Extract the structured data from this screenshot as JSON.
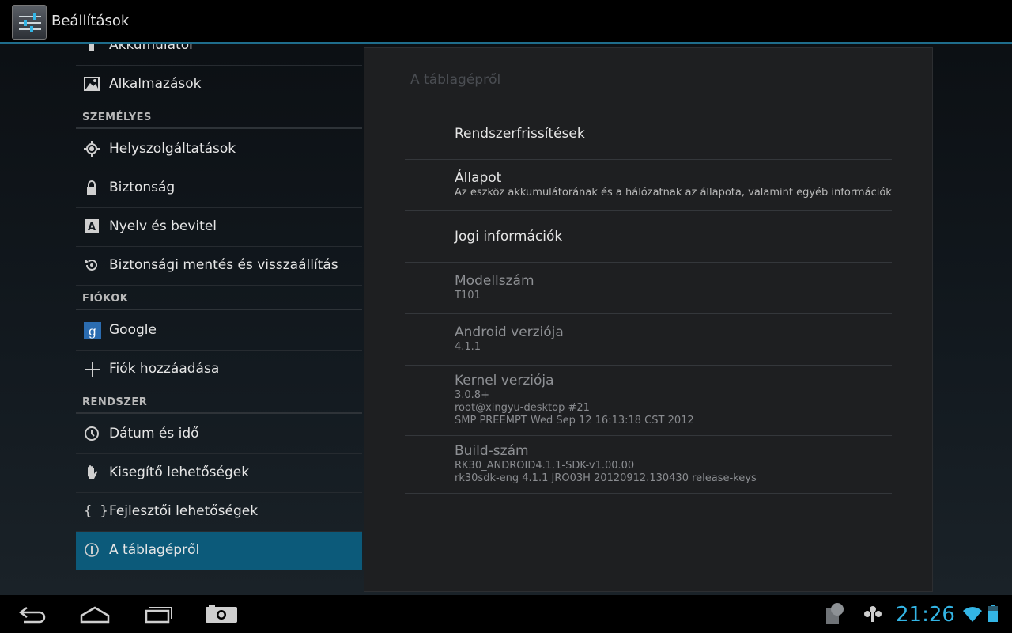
{
  "app": {
    "title": "Beállítások"
  },
  "sidebar": {
    "items": [
      {
        "label": "Akkumulátor",
        "icon": "battery-icon"
      },
      {
        "label": "Alkalmazások",
        "icon": "apps-icon"
      },
      {
        "header": "SZEMÉLYES"
      },
      {
        "label": "Helyszolgáltatások",
        "icon": "location-icon"
      },
      {
        "label": "Biztonság",
        "icon": "lock-icon"
      },
      {
        "label": "Nyelv és bevitel",
        "icon": "keyboard-icon"
      },
      {
        "label": "Biztonsági mentés és visszaállítás",
        "icon": "restore-icon"
      },
      {
        "header": "FIÓKOK"
      },
      {
        "label": "Google",
        "icon": "google-icon"
      },
      {
        "label": "Fiók hozzáadása",
        "icon": "add-icon"
      },
      {
        "header": "RENDSZER"
      },
      {
        "label": "Dátum és idő",
        "icon": "clock-icon"
      },
      {
        "label": "Kisegítő lehetőségek",
        "icon": "hand-icon"
      },
      {
        "label": "Fejlesztői lehetőségek",
        "icon": "braces-icon"
      },
      {
        "label": "A táblagépről",
        "icon": "info-icon",
        "selected": true
      }
    ]
  },
  "detail": {
    "title": "A táblagépről",
    "prefs": [
      {
        "title": "Rendszerfrissítések"
      },
      {
        "title": "Állapot",
        "summary": "Az eszköz akkumulátorának és a hálózatnak az állapota, valamint egyéb információk"
      },
      {
        "title": "Jogi információk"
      },
      {
        "title": "Modellszám",
        "summary": "T101"
      },
      {
        "title": "Android verziója",
        "summary": "4.1.1"
      },
      {
        "title": "Kernel verziója",
        "summary_lines": [
          "3.0.8+",
          "root@xingyu-desktop #21",
          "SMP PREEMPT Wed Sep 12 16:13:18 CST 2012"
        ]
      },
      {
        "title": "Build-szám",
        "summary_lines": [
          "RK30_ANDROID4.1.1-SDK-v1.00.00",
          "rk30sdk-eng 4.1.1 JRO03H 20120912.130430 release-keys"
        ]
      }
    ]
  },
  "statusbar": {
    "time": "21:26",
    "accent_color": "#33b5e5"
  }
}
